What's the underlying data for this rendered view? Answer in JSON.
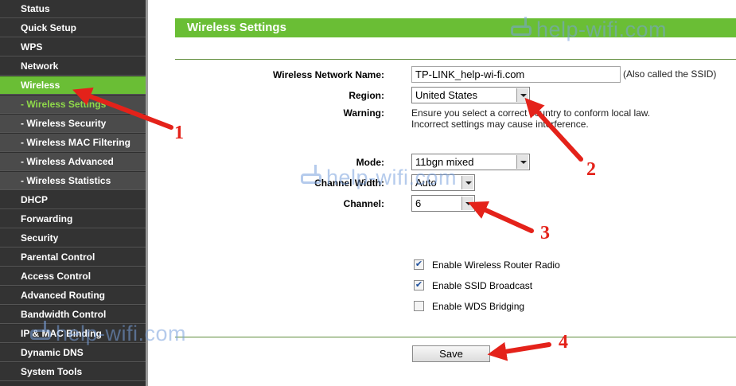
{
  "sidebar": {
    "items": [
      {
        "label": "Status"
      },
      {
        "label": "Quick Setup"
      },
      {
        "label": "WPS"
      },
      {
        "label": "Network"
      },
      {
        "label": "Wireless"
      },
      {
        "label": "- Wireless Settings"
      },
      {
        "label": "- Wireless Security"
      },
      {
        "label": "- Wireless MAC Filtering"
      },
      {
        "label": "- Wireless Advanced"
      },
      {
        "label": "- Wireless Statistics"
      },
      {
        "label": "DHCP"
      },
      {
        "label": "Forwarding"
      },
      {
        "label": "Security"
      },
      {
        "label": "Parental Control"
      },
      {
        "label": "Access Control"
      },
      {
        "label": "Advanced Routing"
      },
      {
        "label": "Bandwidth Control"
      },
      {
        "label": "IP & MAC Binding"
      },
      {
        "label": "Dynamic DNS"
      },
      {
        "label": "System Tools"
      }
    ]
  },
  "main": {
    "title": "Wireless Settings",
    "network_name_label": "Wireless Network Name:",
    "network_name_value": "TP-LINK_help-wi-fi.com",
    "ssid_note": "(Also called the SSID)",
    "region_label": "Region:",
    "region_value": "United States",
    "warning_label": "Warning:",
    "warning_line1": "Ensure you select a correct country to conform local law.",
    "warning_line2": "Incorrect settings may cause interference.",
    "mode_label": "Mode:",
    "mode_value": "11bgn mixed",
    "channel_width_label": "Channel Width:",
    "channel_width_value": "Auto",
    "channel_label": "Channel:",
    "channel_value": "6",
    "checkboxes": [
      {
        "label": "Enable Wireless Router Radio",
        "checked": true
      },
      {
        "label": "Enable SSID Broadcast",
        "checked": true
      },
      {
        "label": "Enable WDS Bridging",
        "checked": false
      }
    ],
    "save_label": "Save"
  },
  "watermark": {
    "text": "help-wifi.com"
  },
  "annotations": {
    "n1": "1",
    "n2": "2",
    "n3": "3",
    "n4": "4"
  },
  "colors": {
    "accent_green": "#6abe35",
    "arrow_red": "#e4221a"
  }
}
